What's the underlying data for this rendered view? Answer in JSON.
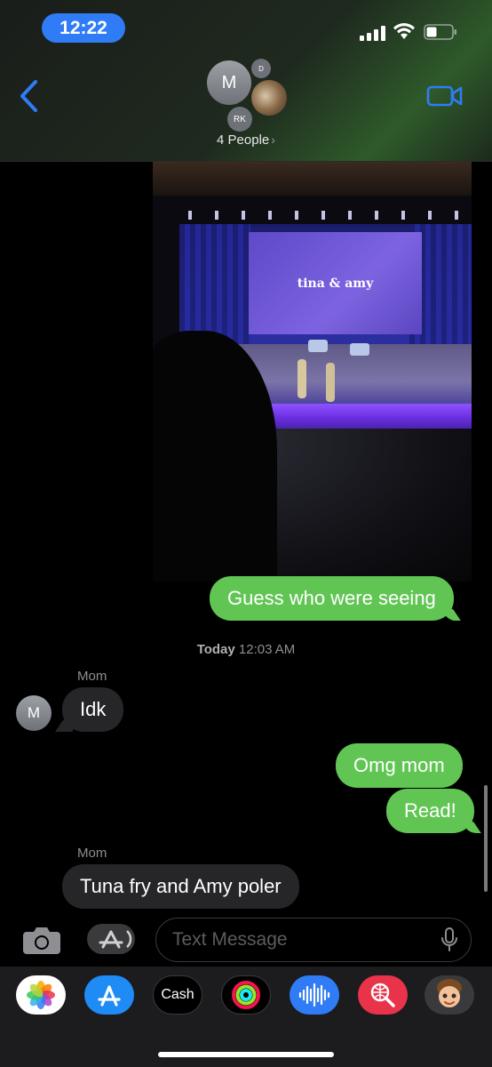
{
  "status_bar": {
    "time": "12:22"
  },
  "header": {
    "avatars": {
      "main_initial": "M",
      "small_initial": "D",
      "bottom_initial": "RK"
    },
    "people_label": "4 People",
    "people_chevron": "›"
  },
  "photo": {
    "screen_text": "tina & amy"
  },
  "messages": {
    "sent_1": "Guess who were seeing",
    "timestamp_day": "Today",
    "timestamp_time": "12:03 AM",
    "sender_1": "Mom",
    "recv_1": "Idk",
    "recv_avatar_initial": "M",
    "sent_2": "Omg mom",
    "sent_3": "Read!",
    "sender_2": "Mom",
    "recv_2": "Tuna fry and Amy poler"
  },
  "input": {
    "placeholder": "Text Message"
  },
  "app_tray": {
    "apps": [
      "photos-app",
      "app-store-app",
      "apple-cash-app",
      "activity-app",
      "voice-memos-app",
      "search-images-app",
      "memoji-app"
    ],
    "cash_label": "Cash",
    "cash_logo": ""
  },
  "colors": {
    "sent_bubble": "#61c554",
    "received_bubble": "#262628",
    "accent": "#2f7cf6"
  }
}
